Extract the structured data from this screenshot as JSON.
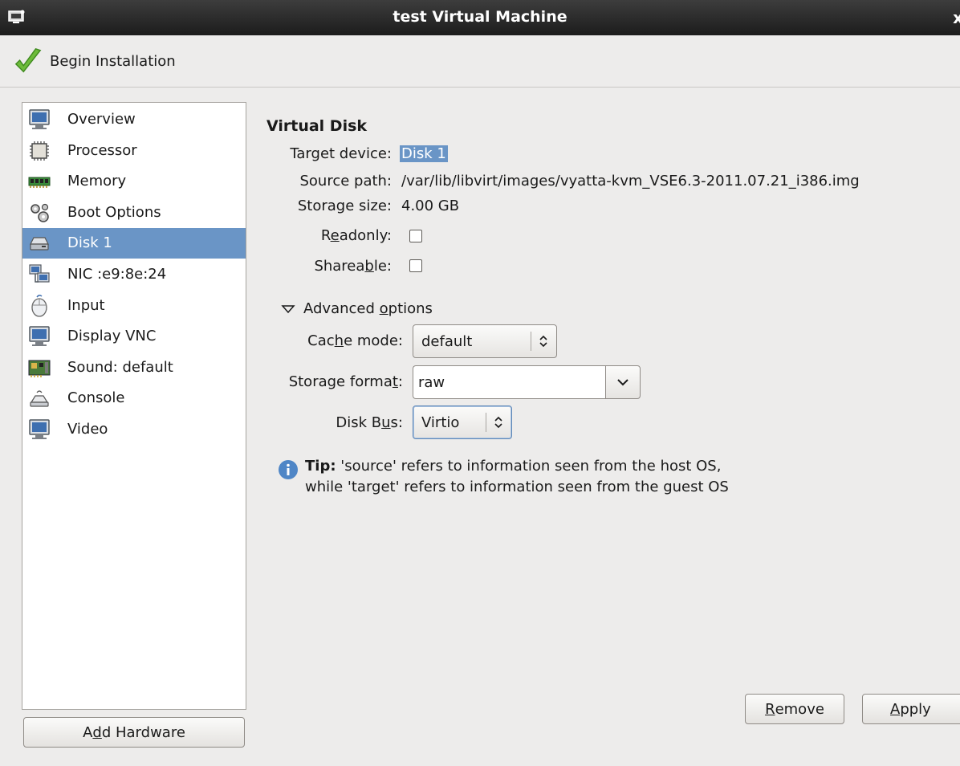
{
  "window": {
    "title": "test Virtual Machine",
    "close_label": "x"
  },
  "toolbar": {
    "begin_installation": "Begin Installation"
  },
  "hardware_list": [
    {
      "label": "Overview",
      "icon": "monitor-icon"
    },
    {
      "label": "Processor",
      "icon": "cpu-icon"
    },
    {
      "label": "Memory",
      "icon": "memory-icon"
    },
    {
      "label": "Boot Options",
      "icon": "gears-icon"
    },
    {
      "label": "Disk 1",
      "icon": "disk-icon",
      "selected": true
    },
    {
      "label": "NIC :e9:8e:24",
      "icon": "network-icon"
    },
    {
      "label": "Input",
      "icon": "mouse-icon"
    },
    {
      "label": "Display VNC",
      "icon": "monitor-icon"
    },
    {
      "label": "Sound: default",
      "icon": "sound-card-icon"
    },
    {
      "label": "Console",
      "icon": "console-icon"
    },
    {
      "label": "Video",
      "icon": "monitor-icon"
    }
  ],
  "add_hardware": {
    "pre": "A",
    "u": "d",
    "post": "d Hardware"
  },
  "disk": {
    "heading": "Virtual Disk",
    "target_label": "Target device:",
    "target_value": "Disk 1",
    "source_label": "Source path:",
    "source_value": "/var/lib/libvirt/images/vyatta-kvm_VSE6.3-2011.07.21_i386.img",
    "size_label": "Storage size:",
    "size_value": "4.00 GB",
    "readonly": {
      "pre": "R",
      "u": "e",
      "post": "adonly:"
    },
    "shareable": {
      "pre": "Sharea",
      "u": "b",
      "post": "le:"
    }
  },
  "advanced": {
    "expander": {
      "pre": "Advanced ",
      "u": "o",
      "post": "ptions"
    },
    "cache_label": {
      "pre": "Cac",
      "u": "h",
      "post": "e mode:"
    },
    "cache_value": "default",
    "format_label": {
      "pre": "Storage forma",
      "u": "t",
      "post": ":"
    },
    "format_value": "raw",
    "bus_label": {
      "pre": "Disk B",
      "u": "u",
      "post": "s:"
    },
    "bus_value": "Virtio"
  },
  "tip": {
    "bold": "Tip:",
    "line1": " 'source' refers to information seen from the host OS,",
    "line2": "while 'target' refers to information seen from the guest OS"
  },
  "actions": {
    "remove": {
      "pre": "",
      "u": "R",
      "post": "emove"
    },
    "apply": {
      "pre": "",
      "u": "A",
      "post": "pply"
    }
  },
  "colors": {
    "selection": "#6a95c6",
    "titlebar": "#2a2a2a",
    "window_bg": "#edeceb"
  }
}
